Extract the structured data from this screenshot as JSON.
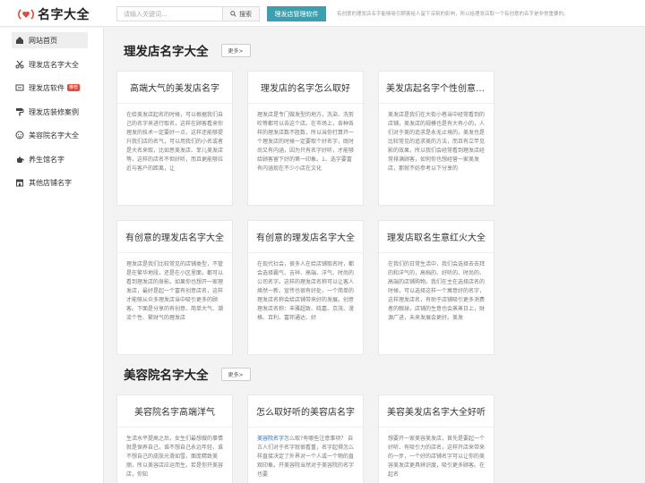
{
  "header": {
    "logo_text": "名字大全",
    "search_placeholder": "请输入关键词...",
    "search_button": "搜索",
    "software_button": "理发店管理软件",
    "notice": "有创意的理发店名字能够吸引顾客给人留下深刻的影响，所以给理发店取一个有创意的名字是非常重要的。"
  },
  "sidebar": {
    "items": [
      {
        "label": "网站首页",
        "icon": "home-icon",
        "active": true
      },
      {
        "label": "理发店名字大全",
        "icon": "scissors-icon"
      },
      {
        "label": "理发店软件",
        "icon": "software-icon",
        "badge": "推荐"
      },
      {
        "label": "理发店装修案例",
        "icon": "paint-roller-icon"
      },
      {
        "label": "美容院名字大全",
        "icon": "face-icon"
      },
      {
        "label": "养生馆名字",
        "icon": "teapot-icon"
      },
      {
        "label": "其他店铺名字",
        "icon": "shop-icon"
      }
    ]
  },
  "sections": [
    {
      "title": "理发店名字大全",
      "more": "更多>",
      "cards": [
        {
          "title": "高端大气的美发店名字",
          "body": "在给美发店起名的时候，可以根据我们自己的名字来进行取名，这样在顾客看来你理发的技术一定要好一点，这样还能够提升我们店的名气，可以用我们的小名或者是大名来取，比如思美发店、菲儿美发店等，这样的店名不但好听，而且更能够拉近与客户的距离，让"
        },
        {
          "title": "理发店的名字怎么取好",
          "body": "理发店是专门做发型的地方，洗染、洗剪吹等都可以去这个店。在市场上，各种各样的理发店数不胜数，所以当你打算开一个理发店的时候一定要取个好名字，既时尚又有内涵，因为只有名字好听，才能够给顾客留下好的第一印象。1、选字要富有内涵现在不少小店在文化"
        },
        {
          "title": "美发店起名字个性创意大全",
          "body": "美发店是我们在大街小巷当中经常看到的店铺，美发店的规模也是有大有小的，人们对于美的追求是永无止境的，美发也是比较常见的追求美的方法，而且有立竿见影的效果，所以我们会经常看到理发店经常排满顾客，如何你也想经营一家美发店，那就不妨参考以下分享的"
        }
      ]
    },
    {
      "title": "",
      "more": "",
      "cards": [
        {
          "title": "有创意的理发店名字大全",
          "body": "理发店是我们比较常见的店铺类型，不管是在繁华地段，还是在小区里面，都可以看到理发店的身影。如果你也想开一家理发店，最好是起一个富有创意店名，这样才能够从众多理发店当中吸引更多的顾客。下面是分享的有创意、简单大气、潮流个性、繁财气的理发店"
        },
        {
          "title": "有创意的理发店名字大全",
          "body": "在现代社会，很多人在给店铺取名时，都会选择霸气、吉祥、高端、洋气、时尚的公司名字。这样的理发店名称可以让客人焕然一新。宣传也很有好处，一个简单的理发店名称会给店铺带来好的发展。创意理发店名称：丰雅超致、晓嘉、京茂、漫格、百利、富邦通达、好"
        },
        {
          "title": "理发店取名生意红火大全",
          "body": "在我们的日常生活中，我们会选择去去拜的和洋气的，高档的、好听的、时尚的、高端的店铺购物。我们在主在选择店名的时候，可以选择这样一个寓意好的名字，这样理发店名，有助于店铺吸引更多消费者的眼球，店铺的生意也会蒸蒸日上，财源广进，未来发展会更好。美发"
        }
      ]
    },
    {
      "title": "美容院名字大全",
      "more": "更多>",
      "cards": [
        {
          "title": "美容院名字高端洋气",
          "body": "生活水平提高之后，女生们最想做的事情就是保养自己，谁不想自己永远年轻，谁不想自己的皮肤光滑如雪。面庞精致美丽，所以美容店应运而生。若是你开美容店，你知"
        },
        {
          "title": "怎么取好听的美容店名字",
          "link": "美容院名字",
          "body": "怎么取?有哪些注意事项？ 自古人们对于名字就很看重，名字起得怎么样直接决定了外界对一个人或一个物的直观印象。开美容院当然对于美容院的名字也要"
        },
        {
          "title": "美容美发店名字大全好听",
          "body": "想要开一家美容美发店，首先是要起一个好听、有吸引力的店名，这样开店来带来的一步，一个好的店铺名字可以让你的美容美发店更具辨识度，吸引更多顾客。在起名"
        }
      ]
    }
  ]
}
